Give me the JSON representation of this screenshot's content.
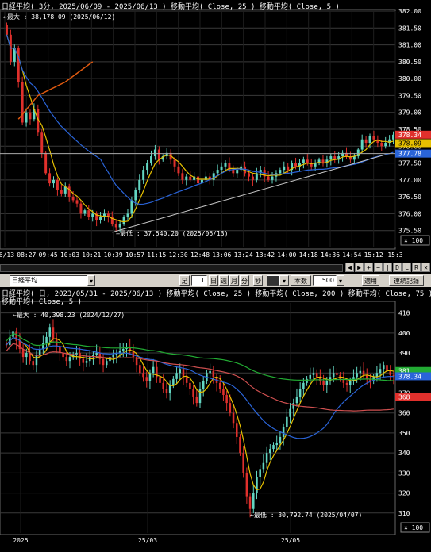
{
  "top": {
    "title": "日経平均( 3分, 2025/06/09 - 2025/06/13 )   移動平均( Close, 25 )   移動平均( Close, 5 )",
    "max_label": "最大 : 38,178.09 (2025/06/12)",
    "min_label": "最低 : 37,540.20 (2025/06/13)",
    "scale_label": "× 100",
    "price_tags": [
      "378.34",
      "378.09",
      "377.78"
    ],
    "time_labels": [
      "06/13",
      "08:27",
      "09:45",
      "10:03",
      "10:21",
      "10:39",
      "10:57",
      "11:15",
      "12:30",
      "12:48",
      "13:06",
      "13:24",
      "13:42",
      "14:00",
      "14:18",
      "14:36",
      "14:54",
      "15:12",
      "15:3"
    ],
    "nav_buttons": [
      "◀",
      "▶",
      "+",
      "−",
      "|",
      "D",
      "L",
      "R",
      "✕"
    ]
  },
  "toolbar": {
    "symbol": "日経平均",
    "ashi_label": "足",
    "count_value": "1",
    "day_label": "日",
    "week_label": "週",
    "month_label": "月",
    "min_label": "分",
    "sec_label": "秒",
    "bars_label": "本数",
    "bars_value": "500",
    "apply_label": "適用",
    "cont_label": "連続記録"
  },
  "bottom": {
    "title": "日経平均( 日, 2023/05/31 - 2025/06/13 )   移動平均( Close, 25 )   移動平均( Close, 200 )   移動平均( Close, 75 )",
    "title2": "移動平均( Close, 5 )",
    "max_label": "最大 : 40,398.23 (2024/12/27)",
    "min_label": "最低 : 30,792.74 (2025/04/07)",
    "scale_label": "× 100",
    "price_tags": [
      "381",
      "378.34",
      "368"
    ],
    "time_labels": [
      "2025",
      "25/03",
      "25/05"
    ]
  },
  "colors": {
    "up": "#63d6c2",
    "down": "#e0302c",
    "ma5": "#e6c000",
    "ma25": "#2a64d8",
    "ma75": "#d05050",
    "ma200": "#22aa33",
    "trend": "#c8c8c8",
    "orange": "#e05a10",
    "grid": "#3a3a3a"
  },
  "chart_data": [
    {
      "type": "candlestick",
      "title": "日経平均( 3分, 2025/06/09 - 2025/06/13 )",
      "unit": "× 100",
      "ylim": [
        375.0,
        382.0
      ],
      "yticks": [
        375.5,
        376.0,
        376.5,
        377.0,
        377.5,
        378.0,
        378.5,
        379.0,
        379.5,
        380.0,
        380.5,
        381.0,
        381.5,
        382.0
      ],
      "close": [
        381.3,
        380.5,
        380.9,
        379.9,
        378.7,
        379.0,
        378.8,
        379.1,
        378.4,
        377.8,
        377.2,
        376.9,
        377.0,
        376.7,
        376.6,
        376.8,
        376.5,
        376.4,
        376.3,
        376.0,
        376.1,
        375.9,
        376.0,
        375.8,
        375.9,
        376.0,
        375.9,
        375.7,
        375.6,
        375.7,
        375.9,
        376.0,
        376.4,
        376.7,
        377.0,
        377.3,
        377.5,
        377.7,
        377.9,
        377.6,
        377.7,
        377.8,
        377.6,
        377.4,
        377.2,
        377.0,
        377.1,
        377.0,
        377.1,
        376.9,
        377.0,
        377.1,
        377.0,
        377.2,
        377.3,
        377.4,
        377.5,
        377.3,
        377.2,
        377.3,
        377.4,
        377.2,
        377.1,
        377.0,
        377.2,
        377.3,
        377.1,
        377.0,
        377.1,
        377.2,
        377.3,
        377.4,
        377.3,
        377.5,
        377.4,
        377.5,
        377.6,
        377.5,
        377.4,
        377.5,
        377.6,
        377.5,
        377.6,
        377.7,
        377.6,
        377.7,
        377.8,
        377.7,
        377.6,
        377.7,
        377.9,
        378.2,
        378.1,
        378.3,
        378.2,
        378.1,
        378.0,
        378.1,
        378.2,
        378.34
      ],
      "ma5_label": "移動平均( Close, 5 )",
      "ma25_label": "移動平均( Close, 25 )",
      "max": 381.78,
      "min": 375.4
    },
    {
      "type": "candlestick",
      "title": "日経平均( 日, 2023/05/31 - 2025/06/13 )",
      "unit": "× 100",
      "ylim": [
        300,
        415
      ],
      "yticks": [
        310,
        320,
        330,
        340,
        350,
        360,
        370,
        380,
        390,
        400,
        410
      ],
      "close": [
        394,
        398,
        401,
        396,
        392,
        388,
        390,
        386,
        384,
        389,
        392,
        395,
        398,
        403,
        397,
        393,
        390,
        388,
        386,
        388,
        389,
        390,
        387,
        385,
        386,
        388,
        389,
        390,
        387,
        384,
        386,
        388,
        389,
        390,
        391,
        392,
        393,
        391,
        388,
        384,
        380,
        378,
        376,
        380,
        383,
        378,
        375,
        372,
        370,
        374,
        377,
        380,
        382,
        378,
        375,
        372,
        368,
        365,
        372,
        376,
        380,
        381,
        378,
        375,
        372,
        369,
        365,
        360,
        355,
        348,
        340,
        330,
        318,
        312,
        320,
        328,
        332,
        335,
        340,
        342,
        344,
        345,
        348,
        353,
        358,
        362,
        365,
        368,
        372,
        375,
        377,
        379,
        380,
        378,
        376,
        374,
        376,
        378,
        380,
        379,
        377,
        375,
        374,
        376,
        378,
        380,
        381,
        379,
        377,
        376,
        378,
        380,
        382,
        384,
        381,
        379,
        378.34
      ],
      "ma_labels": [
        "移動平均( Close, 25 )",
        "移動平均( Close, 200 )",
        "移動平均( Close, 75 )",
        "移動平均( Close, 5 )"
      ],
      "max": 403.98,
      "min": 307.93
    }
  ]
}
